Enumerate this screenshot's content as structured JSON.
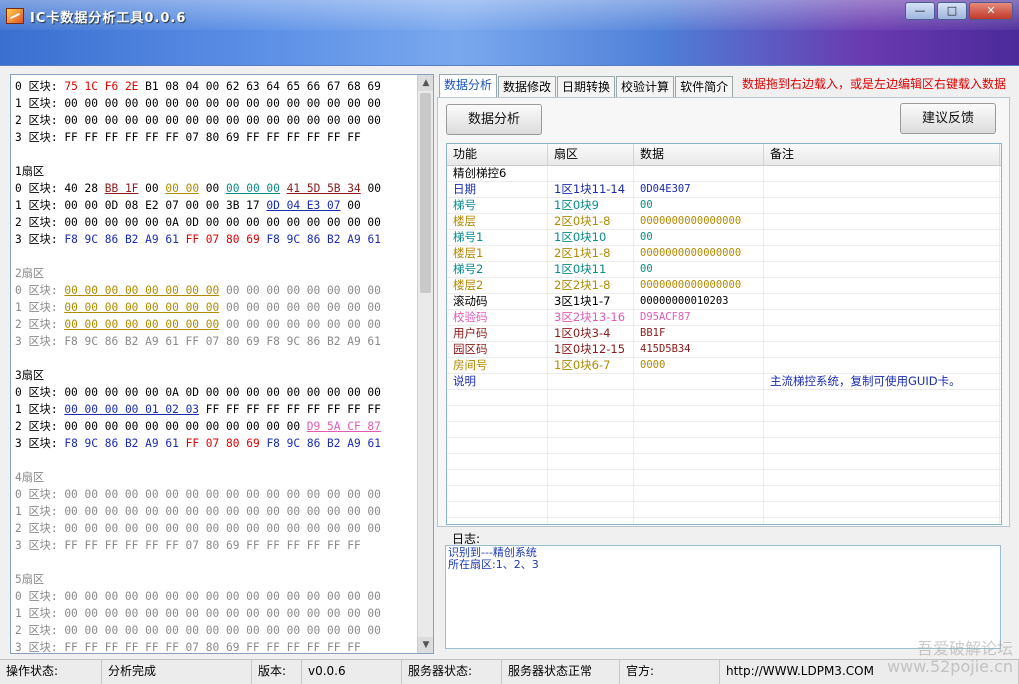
{
  "window": {
    "title": "IC卡数据分析工具0.0.6",
    "minimize": "—",
    "maximize": "□",
    "close": "✕"
  },
  "colors": {
    "red": "#e00000",
    "blue": "#1a2bb0",
    "maroon": "#8b1a1a",
    "olive": "#b08a00",
    "teal": "#0a8a8a",
    "pink": "#e45ab8"
  },
  "hex": {
    "lines": [
      [
        {
          "t": "0 区块: "
        },
        {
          "t": "75 1C F6 2E",
          "c": "red"
        },
        {
          "t": " B1 08 04 00 62 63 64 65 66 67 68 69"
        }
      ],
      [
        {
          "t": "1 区块: 00 00 00 00 00 00 00 00 00 00 00 00 00 00 00 00"
        }
      ],
      [
        {
          "t": "2 区块: 00 00 00 00 00 00 00 00 00 00 00 00 00 00 00 00"
        }
      ],
      [
        {
          "t": "3 区块: FF FF FF FF FF FF 07 80 69 FF FF FF FF FF FF"
        }
      ],
      [
        {
          "t": ""
        }
      ],
      [
        {
          "t": "1扇区"
        }
      ],
      [
        {
          "t": "0 区块: 40 28 "
        },
        {
          "t": "BB 1F",
          "c": "maroon",
          "u": true
        },
        {
          "t": " 00 "
        },
        {
          "t": "00 00",
          "c": "olive",
          "u": true
        },
        {
          "t": " 00 "
        },
        {
          "t": "00 00 00",
          "c": "teal",
          "u": true
        },
        {
          "t": " "
        },
        {
          "t": "41 5D 5B 34",
          "c": "maroon",
          "u": true
        },
        {
          "t": " 00"
        }
      ],
      [
        {
          "t": "1 区块: 00 00 0D 08 E2 07 00 00 3B 17 "
        },
        {
          "t": "0D 04 E3 07",
          "c": "blue",
          "u": true
        },
        {
          "t": " 00"
        }
      ],
      [
        {
          "t": "2 区块: 00 00 00 00 00 0A 0D 00 00 00 00 00 00 00 00 00"
        }
      ],
      [
        {
          "t": "3 区块: "
        },
        {
          "t": "F8 9C 86 B2 A9 61",
          "c": "blue"
        },
        {
          "t": " "
        },
        {
          "t": "FF 07 80 69",
          "c": "red"
        },
        {
          "t": " "
        },
        {
          "t": "F8 9C 86 B2 A9 61",
          "c": "blue"
        }
      ],
      [
        {
          "t": ""
        }
      ],
      [
        {
          "t": "2扇区",
          "c": "dim"
        }
      ],
      [
        {
          "t": "0 区块: ",
          "c": "dim"
        },
        {
          "t": "00 00 00 00 00 00 00 00",
          "c": "olive",
          "u": true
        },
        {
          "t": " 00 00 00 00 00 00 00 00",
          "c": "dim"
        }
      ],
      [
        {
          "t": "1 区块: ",
          "c": "dim"
        },
        {
          "t": "00 00 00 00 00 00 00 00",
          "c": "olive",
          "u": true
        },
        {
          "t": " 00 00 00 00 00 00 00 00",
          "c": "dim"
        }
      ],
      [
        {
          "t": "2 区块: ",
          "c": "dim"
        },
        {
          "t": "00 00 00 00 00 00 00 00",
          "c": "olive",
          "u": true
        },
        {
          "t": " 00 00 00 00 00 00 00 00",
          "c": "dim"
        }
      ],
      [
        {
          "t": "3 区块: F8 9C 86 B2 A9 61 FF 07 80 69 F8 9C 86 B2 A9 61",
          "c": "dim"
        }
      ],
      [
        {
          "t": ""
        }
      ],
      [
        {
          "t": "3扇区"
        }
      ],
      [
        {
          "t": "0 区块: 00 00 00 00 00 0A 0D 00 00 00 00 00 00 00 00 00"
        }
      ],
      [
        {
          "t": "1 区块: "
        },
        {
          "t": "00 00 00 00 01 02 03",
          "c": "blue",
          "u": true
        },
        {
          "t": " FF FF FF FF FF FF FF FF FF"
        }
      ],
      [
        {
          "t": "2 区块: 00 00 00 00 00 00 00 00 00 00 00 00 "
        },
        {
          "t": "D9 5A CF 87",
          "c": "pink",
          "u": true
        }
      ],
      [
        {
          "t": "3 区块: "
        },
        {
          "t": "F8 9C 86 B2 A9 61",
          "c": "blue"
        },
        {
          "t": " "
        },
        {
          "t": "FF 07 80 69",
          "c": "red"
        },
        {
          "t": " "
        },
        {
          "t": "F8 9C 86 B2 A9 61",
          "c": "blue"
        }
      ],
      [
        {
          "t": ""
        }
      ],
      [
        {
          "t": "4扇区",
          "c": "dim"
        }
      ],
      [
        {
          "t": "0 区块: 00 00 00 00 00 00 00 00 00 00 00 00 00 00 00 00",
          "c": "dim"
        }
      ],
      [
        {
          "t": "1 区块: 00 00 00 00 00 00 00 00 00 00 00 00 00 00 00 00",
          "c": "dim"
        }
      ],
      [
        {
          "t": "2 区块: 00 00 00 00 00 00 00 00 00 00 00 00 00 00 00 00",
          "c": "dim"
        }
      ],
      [
        {
          "t": "3 区块: FF FF FF FF FF FF 07 80 69 FF FF FF FF FF FF",
          "c": "dim"
        }
      ],
      [
        {
          "t": ""
        }
      ],
      [
        {
          "t": "5扇区",
          "c": "dim"
        }
      ],
      [
        {
          "t": "0 区块: 00 00 00 00 00 00 00 00 00 00 00 00 00 00 00 00",
          "c": "dim"
        }
      ],
      [
        {
          "t": "1 区块: 00 00 00 00 00 00 00 00 00 00 00 00 00 00 00 00",
          "c": "dim"
        }
      ],
      [
        {
          "t": "2 区块: 00 00 00 00 00 00 00 00 00 00 00 00 00 00 00 00",
          "c": "dim"
        }
      ],
      [
        {
          "t": "3 区块: FF FF FF FF FF FF 07 80 69 FF FF FF FF FF FF",
          "c": "dim"
        }
      ]
    ]
  },
  "tabs": [
    {
      "label": "数据分析",
      "active": true
    },
    {
      "label": "数据修改"
    },
    {
      "label": "日期转换"
    },
    {
      "label": "校验计算"
    },
    {
      "label": "软件简介"
    }
  ],
  "hint": "数据拖到右边载入，或是左边编辑区右键载入数据",
  "buttons": {
    "analyze": "数据分析",
    "feedback": "建议反馈"
  },
  "grid": {
    "headers": [
      "功能",
      "扇区",
      "数据",
      "备注"
    ],
    "rows": [
      {
        "f": "精创梯控6",
        "s": "",
        "d": "",
        "n": "",
        "c": ""
      },
      {
        "f": "日期",
        "s": "1区1块11-14",
        "d": "0D04E307",
        "n": "",
        "c": "blue"
      },
      {
        "f": "梯号",
        "s": "1区0块9",
        "d": "00",
        "n": "",
        "c": "teal"
      },
      {
        "f": "楼层",
        "s": "2区0块1-8",
        "d": "0000000000000000",
        "n": "",
        "c": "olive"
      },
      {
        "f": "梯号1",
        "s": "1区0块10",
        "d": "00",
        "n": "",
        "c": "teal"
      },
      {
        "f": "楼层1",
        "s": "2区1块1-8",
        "d": "0000000000000000",
        "n": "",
        "c": "olive"
      },
      {
        "f": "梯号2",
        "s": "1区0块11",
        "d": "00",
        "n": "",
        "c": "teal"
      },
      {
        "f": "楼层2",
        "s": "2区2块1-8",
        "d": "0000000000000000",
        "n": "",
        "c": "olive"
      },
      {
        "f": "滚动码",
        "s": "3区1块1-7",
        "d": "00000000010203",
        "n": "",
        "c": ""
      },
      {
        "f": "校验码",
        "s": "3区2块13-16",
        "d": "D95ACF87",
        "n": "",
        "c": "pink"
      },
      {
        "f": "用户码",
        "s": "1区0块3-4",
        "d": "BB1F",
        "n": "",
        "c": "maroon"
      },
      {
        "f": "园区码",
        "s": "1区0块12-15",
        "d": "415D5B34",
        "n": "",
        "c": "maroon"
      },
      {
        "f": "房间号",
        "s": "1区0块6-7",
        "d": "0000",
        "n": "",
        "c": "olive"
      },
      {
        "f": "说明",
        "s": "",
        "d": "",
        "n": "主流梯控系统，复制可使用GUID卡。",
        "c": "blue"
      }
    ],
    "empty_rows": 9
  },
  "log": {
    "label": "日志:",
    "lines": [
      "识别到---精创系统",
      "所在扇区:1、2、3"
    ]
  },
  "status": [
    {
      "label": "操作状态:",
      "w": 102
    },
    {
      "label": "分析完成",
      "w": 150
    },
    {
      "label": "版本:",
      "w": 50
    },
    {
      "label": "v0.0.6",
      "w": 100
    },
    {
      "label": "服务器状态:",
      "w": 100
    },
    {
      "label": "服务器状态正常",
      "w": 118
    },
    {
      "label": "官方:",
      "w": 100
    },
    {
      "label": "http://WWW.LDPM3.COM",
      "w": 299
    }
  ],
  "watermark": {
    "line1": "吾爱破解论坛",
    "line2": "www.52pojie.cn"
  }
}
